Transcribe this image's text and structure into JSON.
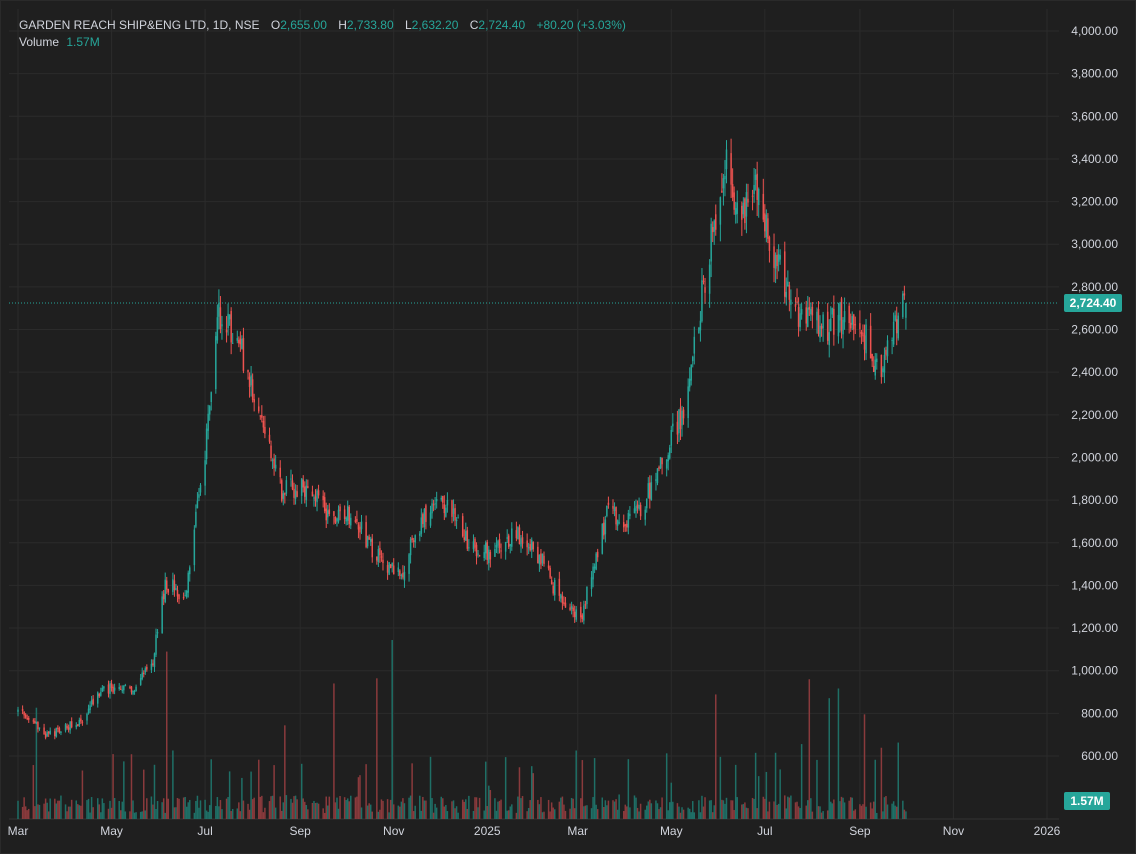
{
  "legend": {
    "symbol": "GARDEN REACH SHIP&ENG LTD, 1D, NSE",
    "open_label": "O",
    "open": "2,655.00",
    "high_label": "H",
    "high": "2,733.80",
    "low_label": "L",
    "low": "2,632.20",
    "close_label": "C",
    "close": "2,724.40",
    "change": "+80.20 (+3.03%)",
    "volume_label": "Volume",
    "volume": "1.57M"
  },
  "price_tag": "2,724.40",
  "volume_tag": "1.57M",
  "colors": {
    "background": "#1f1f1f",
    "grid": "#2b2b2b",
    "up": "#26a69a",
    "down": "#ef5350",
    "volume_up": "#1f6f66",
    "volume_down": "#8a3a3c",
    "tag": "#26a69a"
  },
  "chart_data": {
    "type": "candlestick",
    "title": "GARDEN REACH SHIP&ENG LTD, 1D, NSE",
    "y_ticks": [
      "4,000.00",
      "3,800.00",
      "3,600.00",
      "3,400.00",
      "3,200.00",
      "3,000.00",
      "2,800.00",
      "2,600.00",
      "2,400.00",
      "2,200.00",
      "2,000.00",
      "1,800.00",
      "1,600.00",
      "1,400.00",
      "1,200.00",
      "1,000.00",
      "800.00",
      "600.00"
    ],
    "ylim": [
      530,
      4080
    ],
    "x_ticks": [
      "Mar",
      "May",
      "Jul",
      "Sep",
      "Nov",
      "2025",
      "Mar",
      "May",
      "Jul",
      "Sep",
      "Nov",
      "2026"
    ],
    "last_close": 2724.4,
    "grid": true,
    "price_anchors": [
      [
        "2024-03-01",
        810
      ],
      [
        "2024-03-20",
        700
      ],
      [
        "2024-04-10",
        760
      ],
      [
        "2024-04-25",
        920
      ],
      [
        "2024-05-15",
        910
      ],
      [
        "2024-05-28",
        1050
      ],
      [
        "2024-06-05",
        1420
      ],
      [
        "2024-06-18",
        1340
      ],
      [
        "2024-07-01",
        2000
      ],
      [
        "2024-07-10",
        2680
      ],
      [
        "2024-07-22",
        2560
      ],
      [
        "2024-08-05",
        2250
      ],
      [
        "2024-08-20",
        1850
      ],
      [
        "2024-09-05",
        1850
      ],
      [
        "2024-09-20",
        1740
      ],
      [
        "2024-10-05",
        1730
      ],
      [
        "2024-10-20",
        1540
      ],
      [
        "2024-11-05",
        1440
      ],
      [
        "2024-11-20",
        1720
      ],
      [
        "2024-12-05",
        1790
      ],
      [
        "2024-12-20",
        1600
      ],
      [
        "2025-01-05",
        1550
      ],
      [
        "2025-01-20",
        1660
      ],
      [
        "2025-02-05",
        1520
      ],
      [
        "2025-02-20",
        1300
      ],
      [
        "2025-03-03",
        1250
      ],
      [
        "2025-03-20",
        1740
      ],
      [
        "2025-04-05",
        1700
      ],
      [
        "2025-04-20",
        1880
      ],
      [
        "2025-05-10",
        2250
      ],
      [
        "2025-05-22",
        2800
      ],
      [
        "2025-06-05",
        3400
      ],
      [
        "2025-06-15",
        3100
      ],
      [
        "2025-06-25",
        3250
      ],
      [
        "2025-07-05",
        3000
      ],
      [
        "2025-07-20",
        2700
      ],
      [
        "2025-08-05",
        2600
      ],
      [
        "2025-08-20",
        2650
      ],
      [
        "2025-09-05",
        2550
      ],
      [
        "2025-09-15",
        2380
      ],
      [
        "2025-09-25",
        2650
      ],
      [
        "2025-10-01",
        2724
      ]
    ]
  }
}
